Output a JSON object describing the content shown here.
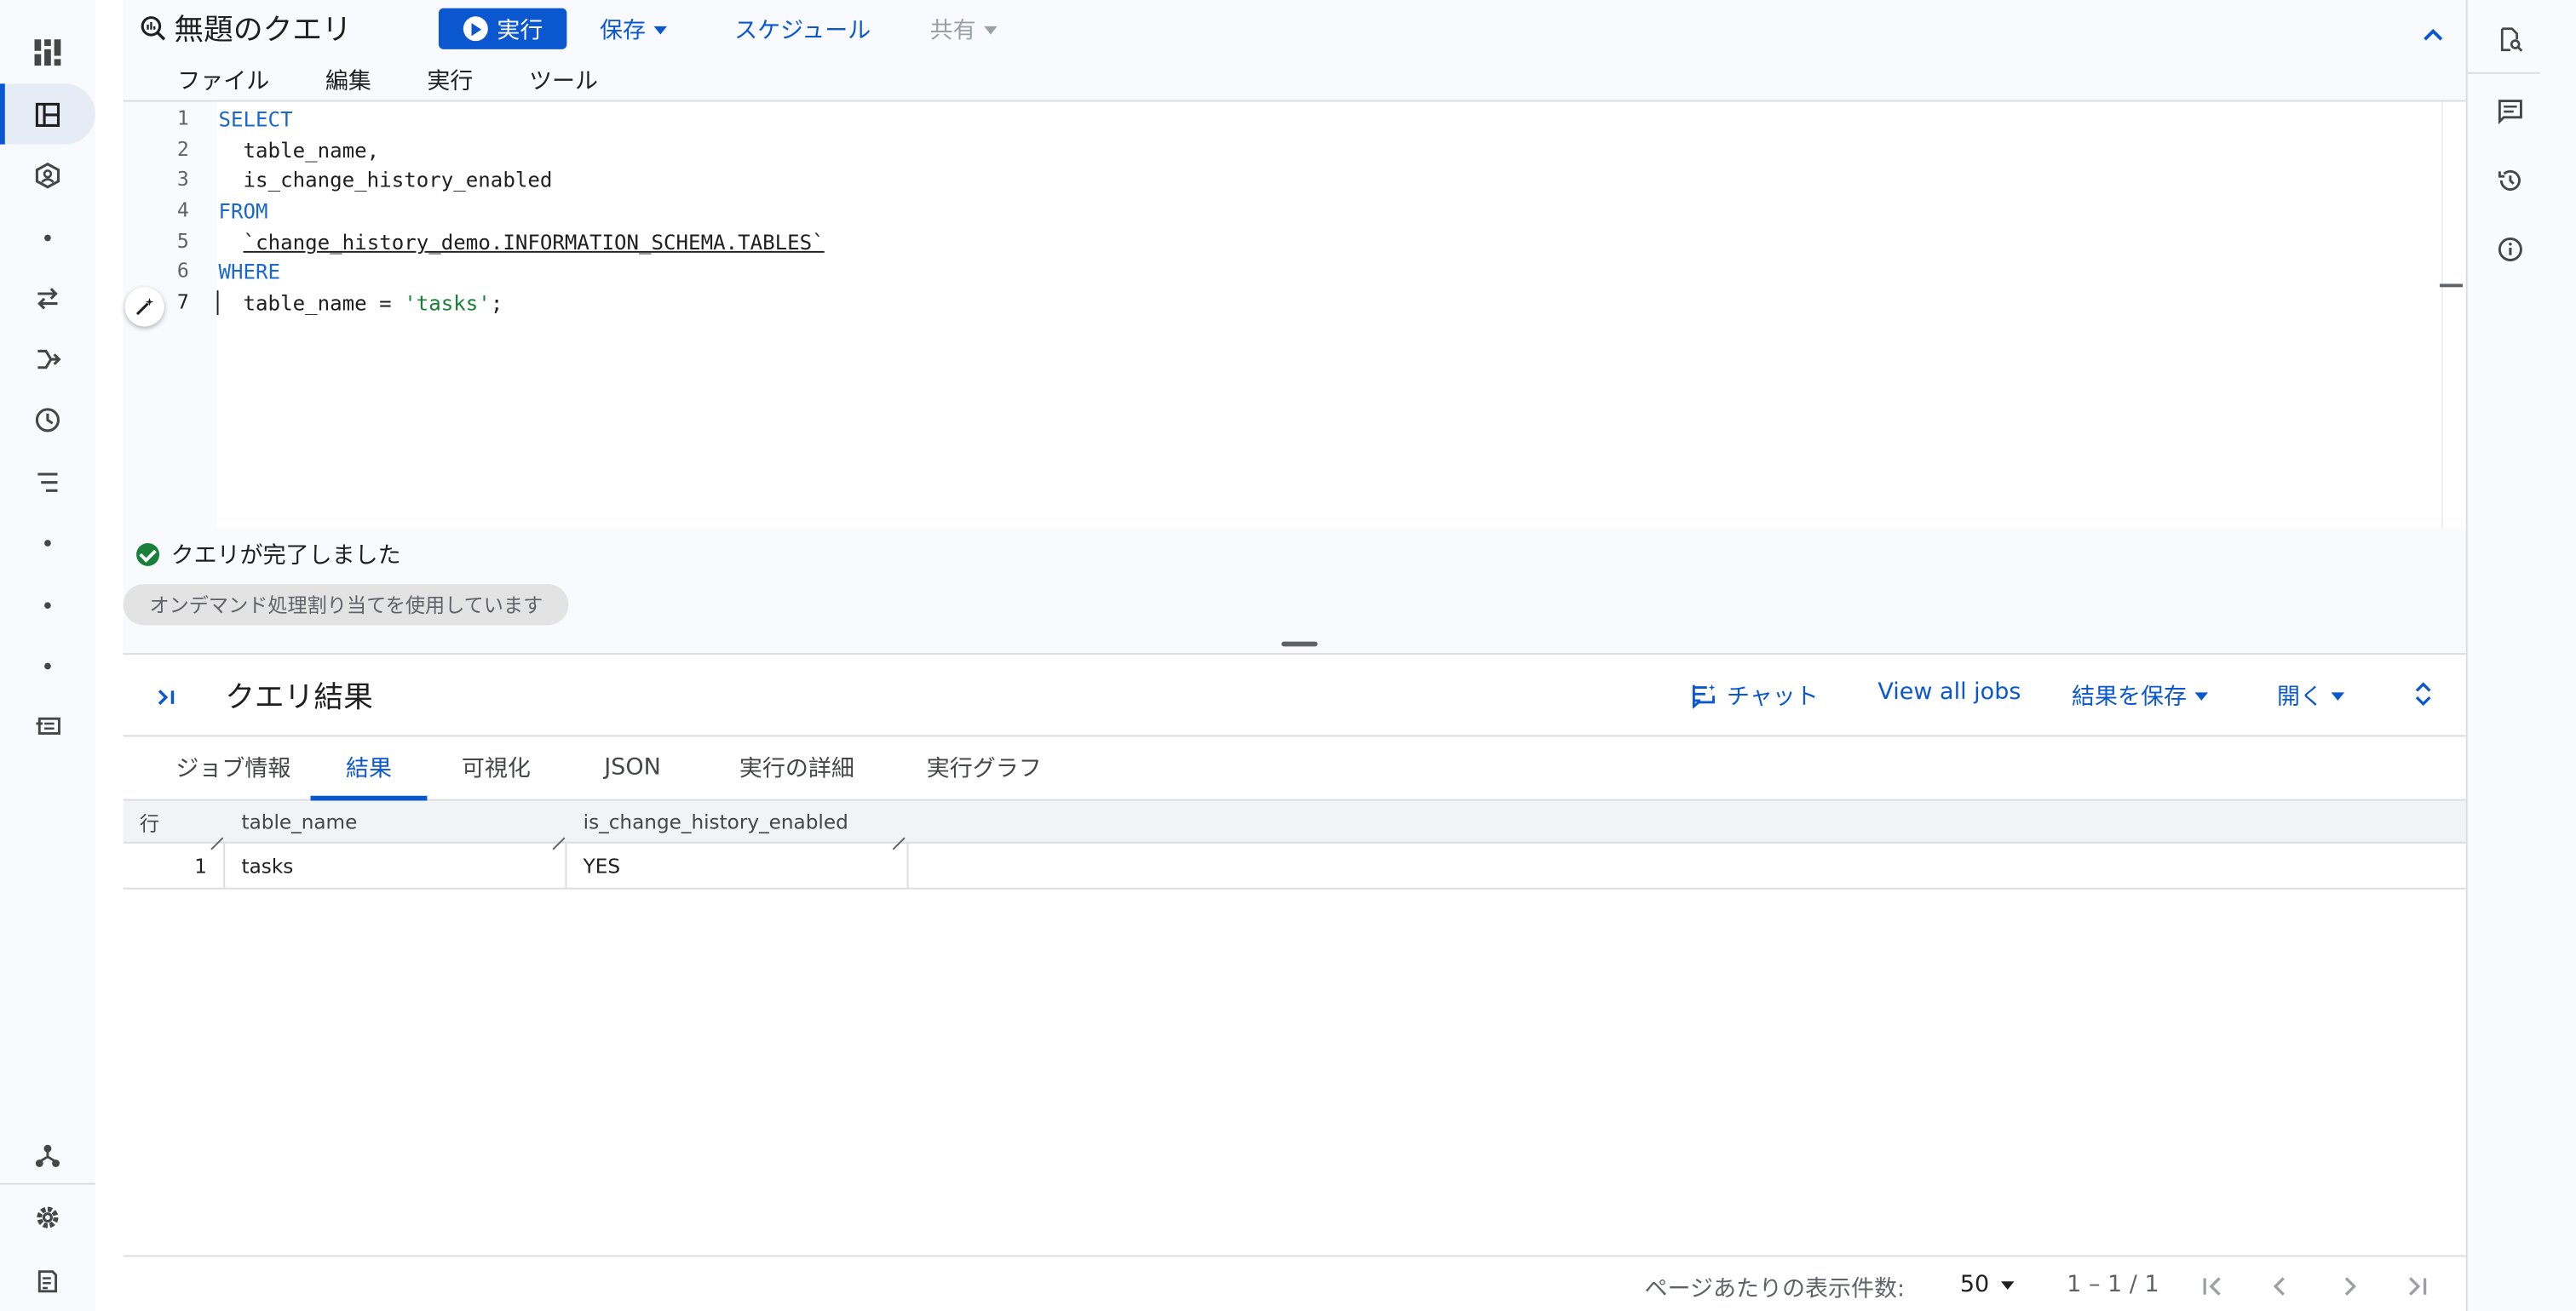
{
  "app": {
    "query_title": "無題のクエリ",
    "run_label": "実行",
    "save_label": "保存",
    "schedule_label": "スケジュール",
    "share_label": "共有"
  },
  "menu": {
    "items": [
      "ファイル",
      "編集",
      "実行",
      "ツール"
    ]
  },
  "editor": {
    "line_numbers": [
      "1",
      "2",
      "3",
      "4",
      "5",
      "6",
      "7"
    ],
    "lines": [
      {
        "parts": [
          {
            "t": "SELECT",
            "c": "kw"
          }
        ]
      },
      {
        "parts": [
          {
            "t": "  table_name,",
            "c": ""
          }
        ]
      },
      {
        "parts": [
          {
            "t": "  is_change_history_enabled",
            "c": ""
          }
        ]
      },
      {
        "parts": [
          {
            "t": "FROM",
            "c": "kw"
          }
        ]
      },
      {
        "parts": [
          {
            "t": "  ",
            "c": ""
          },
          {
            "t": "`change_history_demo.INFORMATION_SCHEMA.TABLES`",
            "c": "tbl"
          }
        ]
      },
      {
        "parts": [
          {
            "t": "WHERE",
            "c": "kw"
          }
        ]
      },
      {
        "parts": [
          {
            "t": "  table_name = ",
            "c": ""
          },
          {
            "t": "'tasks'",
            "c": "str"
          },
          {
            "t": ";",
            "c": ""
          }
        ]
      }
    ]
  },
  "status": {
    "message": "クエリが完了しました",
    "chip": "オンデマンド処理割り当てを使用しています"
  },
  "results": {
    "title": "クエリ結果",
    "chat_label": "チャット",
    "view_all_jobs_label": "View all jobs",
    "save_results_label": "結果を保存",
    "open_label": "開く",
    "tabs": [
      "ジョブ情報",
      "結果",
      "可視化",
      "JSON",
      "実行の詳細",
      "実行グラフ"
    ],
    "active_tab": "結果",
    "columns": [
      "行",
      "table_name",
      "is_change_history_enabled"
    ],
    "rows": [
      [
        "1",
        "tasks",
        "YES"
      ]
    ]
  },
  "footer": {
    "page_size_label": "ページあたりの表示件数:",
    "page_size": "50",
    "range": "1 – 1 / 1"
  },
  "colors": {
    "accent": "#0b57d0",
    "success": "#188038",
    "keyword": "#1967d2"
  }
}
